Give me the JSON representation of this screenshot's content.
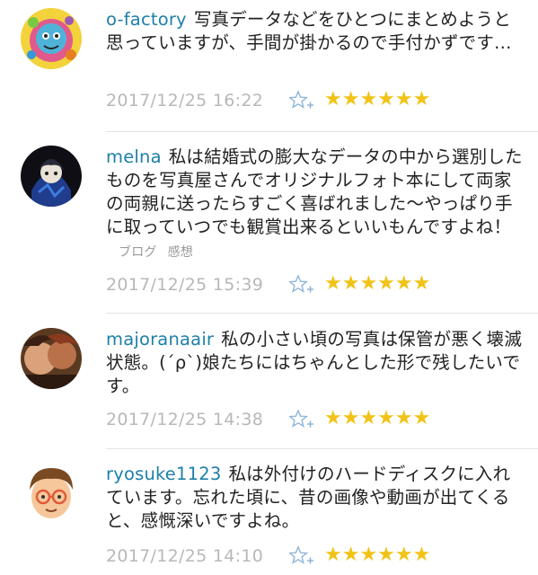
{
  "comments": [
    {
      "username": "o-factory",
      "text": "写真データなどをひとつにまとめようと思っていますが、手間が掛かるので手付かずです…",
      "timestamp": "2017/12/25 16:22",
      "stars": "★★★★★★",
      "avatar_icon": "colorful-character-avatar",
      "tags": []
    },
    {
      "username": "melna",
      "text": "私は結婚式の膨大なデータの中から選別したものを写真屋さんでオリジナルフォト本にして両家の両親に送ったらすごく喜ばれました〜やっぱり手に取っていつでも観賞出来るといいもんですよね！",
      "timestamp": "2017/12/25 15:39",
      "stars": "★★★★★★",
      "avatar_icon": "dark-anime-character-avatar",
      "tags": [
        "ブログ",
        "感想"
      ]
    },
    {
      "username": "majoranaair",
      "text": "私の小さい頃の写真は保管が悪く壊滅状態。(´ρ`)娘たちにはちゃんとした形で残したいです。",
      "timestamp": "2017/12/25 14:38",
      "stars": "★★★★★★",
      "avatar_icon": "painting-portrait-avatar",
      "tags": []
    },
    {
      "username": "ryosuke1123",
      "text": "私は外付けのハードディスクに入れています。忘れた頃に、昔の画像や動画が出てくると、感慨深いですよね。",
      "timestamp": "2017/12/25 14:10",
      "stars": "★★★★★★",
      "avatar_icon": "glasses-boy-avatar",
      "tags": []
    }
  ],
  "colors": {
    "username": "#1e7fa8",
    "timestamp": "#b8b8b8",
    "star": "#f1c318",
    "fav_icon": "#8fb6d8",
    "tag": "#9a9a9a"
  }
}
